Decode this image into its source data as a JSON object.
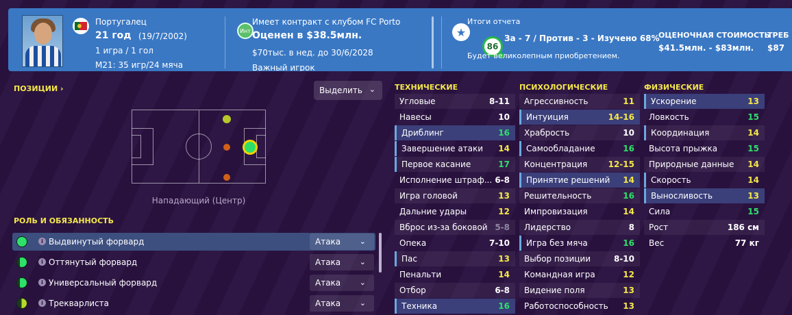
{
  "header": {
    "nationality": "Португалец",
    "age": "21 год",
    "birth": "(19/7/2002)",
    "games": "1 игра / 1 гол",
    "u21": "М21: 35 игр/24 мяча",
    "club_icon": "Инт",
    "contract": "Имеет контракт с клубом FC Porto",
    "value": "Оценен в $38.5млн.",
    "wage": "$70тыс. в нед. до 30/6/2028",
    "important": "Важный игрок",
    "report_title": "Итоги отчета",
    "rating": "86",
    "report_stats": "За - 7 / Против - 3 - Изучено 68%",
    "report_note": "Будет великолепным приобретением.",
    "est_label": "ОЦЕНОЧНАЯ СТОИМОСТЬ",
    "est_value": "$41.5млн. - $83млн.",
    "req_label": "ТРЕБ",
    "req_value": "$87"
  },
  "positions": {
    "title": "ПОЗИЦИИ",
    "select_label": "Выделить",
    "position_name": "Нападающий (Центр)"
  },
  "roles": {
    "title": "РОЛЬ И ОБЯЗАННОСТЬ",
    "items": [
      {
        "name": "Выдвинутый форвард",
        "duty": "Атака"
      },
      {
        "name": "Оттянутый форвард",
        "duty": "Атака"
      },
      {
        "name": "Универсальный форвард",
        "duty": "Атака"
      },
      {
        "name": "Трекварлиста",
        "duty": "Атака"
      }
    ]
  },
  "technical": {
    "title": "ТЕХНИЧЕСКИЕ",
    "items": [
      {
        "name": "Угловые",
        "value": "8-11"
      },
      {
        "name": "Навесы",
        "value": "10"
      },
      {
        "name": "Дриблинг",
        "value": "16"
      },
      {
        "name": "Завершение атаки",
        "value": "14"
      },
      {
        "name": "Первое касание",
        "value": "17"
      },
      {
        "name": "Исполнение штраф...",
        "value": "6-8"
      },
      {
        "name": "Игра головой",
        "value": "13"
      },
      {
        "name": "Дальние удары",
        "value": "12"
      },
      {
        "name": "Вброс из-за боковой",
        "value": "5-8"
      },
      {
        "name": "Опека",
        "value": "7-10"
      },
      {
        "name": "Пас",
        "value": "13"
      },
      {
        "name": "Пенальти",
        "value": "14"
      },
      {
        "name": "Отбор",
        "value": "6-8"
      },
      {
        "name": "Техника",
        "value": "16"
      }
    ]
  },
  "mental": {
    "title": "ПСИХОЛОГИЧЕСКИЕ",
    "items": [
      {
        "name": "Агрессивность",
        "value": "11"
      },
      {
        "name": "Интуиция",
        "value": "14-16"
      },
      {
        "name": "Храбрость",
        "value": "10"
      },
      {
        "name": "Самообладание",
        "value": "16"
      },
      {
        "name": "Концентрация",
        "value": "12-15"
      },
      {
        "name": "Принятие решений",
        "value": "14"
      },
      {
        "name": "Решительность",
        "value": "16"
      },
      {
        "name": "Импровизация",
        "value": "14"
      },
      {
        "name": "Лидерство",
        "value": "8"
      },
      {
        "name": "Игра без мяча",
        "value": "16"
      },
      {
        "name": "Выбор позиции",
        "value": "8-10"
      },
      {
        "name": "Командная игра",
        "value": "12"
      },
      {
        "name": "Видение поля",
        "value": "13"
      },
      {
        "name": "Работоспособность",
        "value": "13"
      }
    ]
  },
  "physical": {
    "title": "ФИЗИЧЕСКИЕ",
    "items": [
      {
        "name": "Ускорение",
        "value": "13"
      },
      {
        "name": "Ловкость",
        "value": "15"
      },
      {
        "name": "Координация",
        "value": "14"
      },
      {
        "name": "Высота прыжка",
        "value": "15"
      },
      {
        "name": "Природные данные",
        "value": "14"
      },
      {
        "name": "Скорость",
        "value": "14"
      },
      {
        "name": "Выносливость",
        "value": "13"
      },
      {
        "name": "Сила",
        "value": "15"
      },
      {
        "name": "Рост",
        "value": "186 см"
      },
      {
        "name": "Вес",
        "value": "77 кг"
      }
    ]
  },
  "colors": {
    "value_high": "#2ee06a",
    "value_mid": "#f5e84a",
    "value_low": "#ffffff",
    "value_dim": "#8f86a2",
    "accent": "#3a78c4"
  }
}
